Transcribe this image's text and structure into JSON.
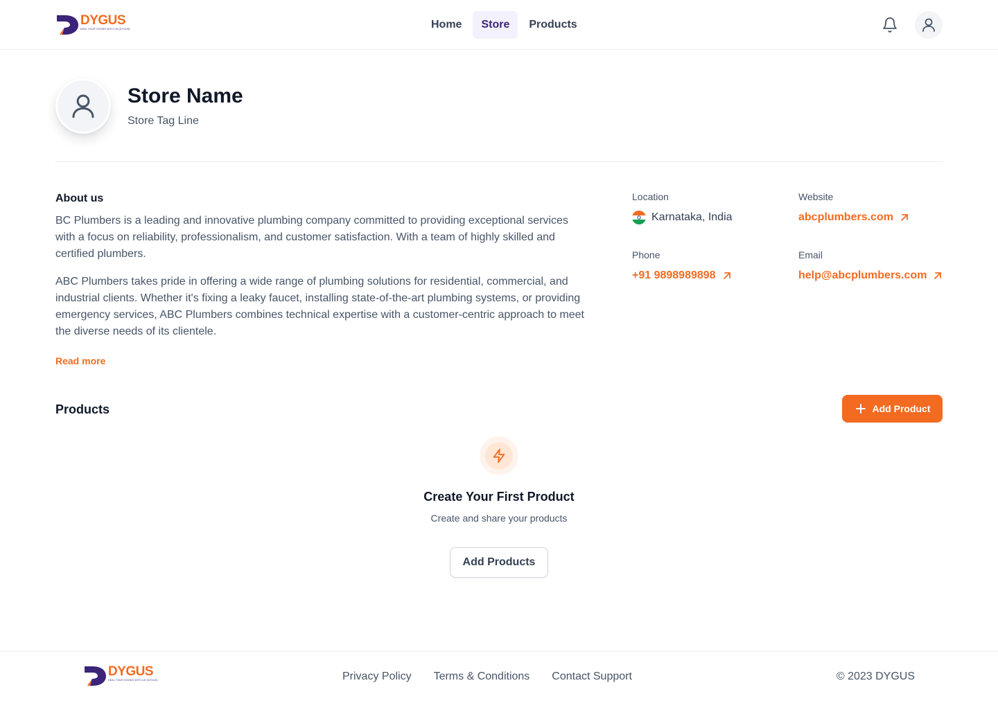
{
  "header": {
    "logo_text": "DYGUS",
    "logo_tagline": "DEAL YOUR GOODS WITH US (DYGUS)",
    "nav": [
      {
        "label": "Home",
        "active": false
      },
      {
        "label": "Store",
        "active": true
      },
      {
        "label": "Products",
        "active": false
      }
    ],
    "icons": {
      "notifications": "bell-icon",
      "account": "user-icon"
    }
  },
  "store": {
    "name": "Store Name",
    "tagline": "Store Tag Line"
  },
  "about": {
    "title": "About us",
    "paragraphs": [
      "BC Plumbers is a leading and innovative plumbing company committed to providing exceptional services with a focus on reliability, professionalism, and customer satisfaction. With a team of highly skilled and certified plumbers.",
      "ABC Plumbers takes pride in offering a wide range of plumbing solutions for residential, commercial, and industrial clients. Whether it's fixing a leaky faucet, installing state-of-the-art plumbing systems, or providing emergency services, ABC Plumbers combines technical expertise with a customer-centric approach to meet the diverse needs of its clientele."
    ],
    "read_more": "Read more"
  },
  "info": {
    "location": {
      "label": "Location",
      "value": "Karnataka, India"
    },
    "website": {
      "label": "Website",
      "value": "abcplumbers.com"
    },
    "phone": {
      "label": "Phone",
      "value": "+91 9898989898"
    },
    "email": {
      "label": "Email",
      "value": "help@abcplumbers.com"
    }
  },
  "products": {
    "title": "Products",
    "add_button": "Add Product",
    "empty": {
      "title": "Create Your First Product",
      "subtitle": "Create and share your products",
      "button": "Add Products"
    }
  },
  "footer": {
    "links": [
      "Privacy Policy",
      "Terms & Conditions",
      "Contact Support"
    ],
    "copyright": "© 2023 DYGUS"
  },
  "colors": {
    "accent": "#f26b21",
    "brand_purple": "#3b2479",
    "nav_active_bg": "#f4f1ff"
  }
}
